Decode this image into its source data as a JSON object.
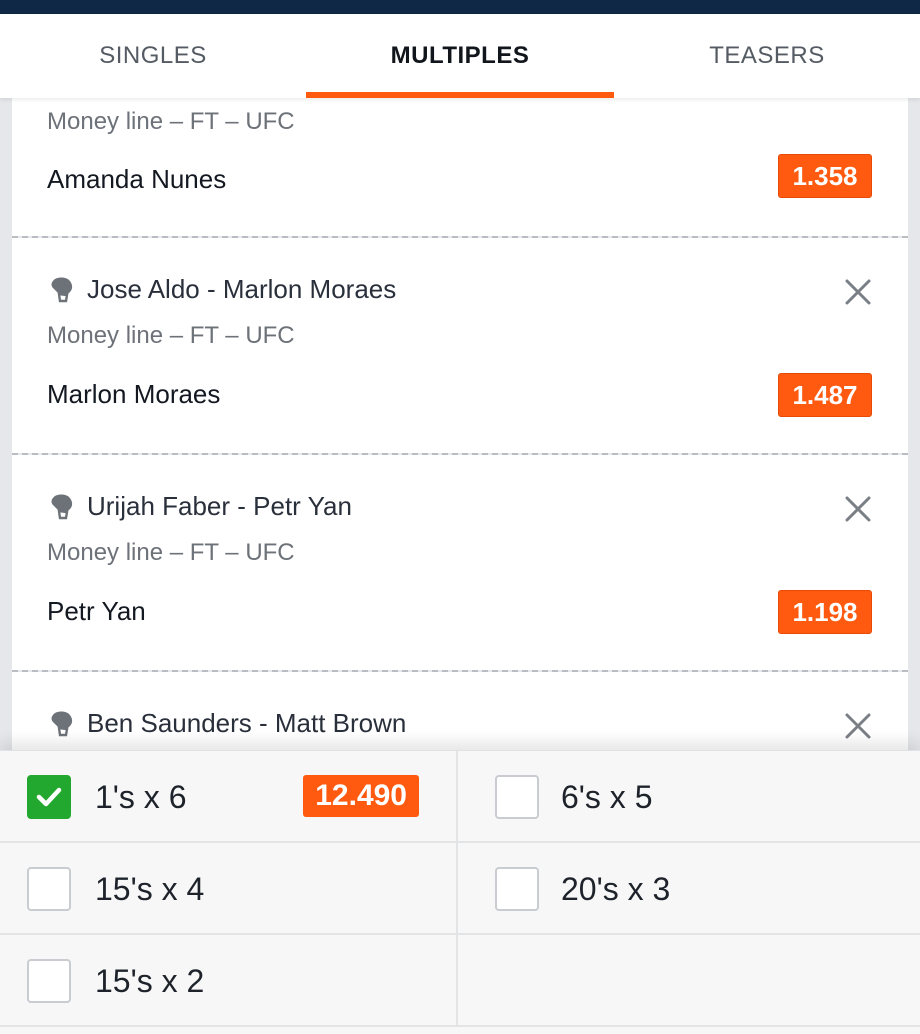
{
  "tabs": [
    {
      "label": "SINGLES",
      "active": false
    },
    {
      "label": "MULTIPLES",
      "active": true
    },
    {
      "label": "TEASERS",
      "active": false
    }
  ],
  "selections": [
    {
      "event": "",
      "market": "Money line – FT – UFC",
      "pick": "Amanda Nunes",
      "odds": "1.358"
    },
    {
      "event": "Jose Aldo - Marlon Moraes",
      "market": "Money line – FT – UFC",
      "pick": "Marlon Moraes",
      "odds": "1.487"
    },
    {
      "event": "Urijah Faber - Petr Yan",
      "market": "Money line – FT – UFC",
      "pick": "Petr Yan",
      "odds": "1.198"
    },
    {
      "event": "Ben Saunders - Matt Brown",
      "market": "",
      "pick": "",
      "odds": ""
    }
  ],
  "multiples": [
    {
      "label": "1's x 6",
      "checked": true,
      "odds": "12.490"
    },
    {
      "label": "6's x 5",
      "checked": false
    },
    {
      "label": "15's x 4",
      "checked": false
    },
    {
      "label": "20's x 3",
      "checked": false
    },
    {
      "label": "15's x 2",
      "checked": false
    }
  ],
  "colors": {
    "accent": "#ff5a0f",
    "topbar": "#0f2846",
    "checked": "#22a82e"
  },
  "icons": {
    "event": "boxing-glove-icon",
    "remove": "close-icon",
    "checkmark": "checkmark-icon"
  }
}
